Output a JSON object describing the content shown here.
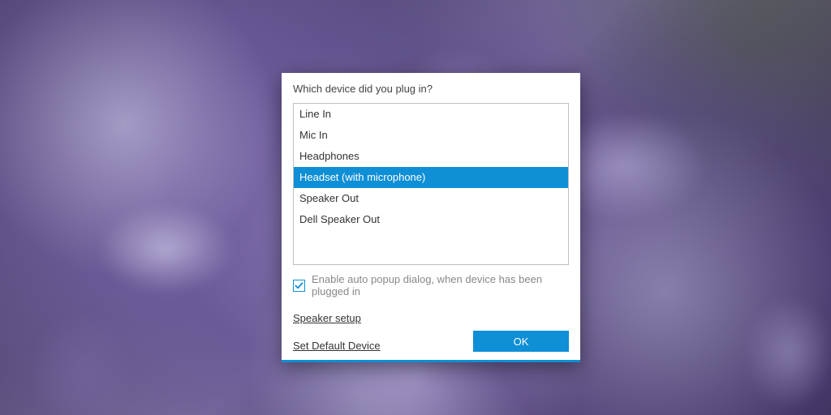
{
  "dialog": {
    "title": "Which device did you plug in?",
    "devices": [
      {
        "label": "Line In",
        "selected": false
      },
      {
        "label": "Mic In",
        "selected": false
      },
      {
        "label": "Headphones",
        "selected": false
      },
      {
        "label": "Headset (with microphone)",
        "selected": true
      },
      {
        "label": "Speaker Out",
        "selected": false
      },
      {
        "label": "Dell Speaker Out",
        "selected": false
      }
    ],
    "auto_popup": {
      "checked": true,
      "label": "Enable auto popup dialog, when device has been plugged in"
    },
    "links": {
      "speaker_setup": "Speaker setup",
      "set_default": "Set Default Device"
    },
    "ok_label": "OK",
    "accent": "#0e8fd6"
  }
}
